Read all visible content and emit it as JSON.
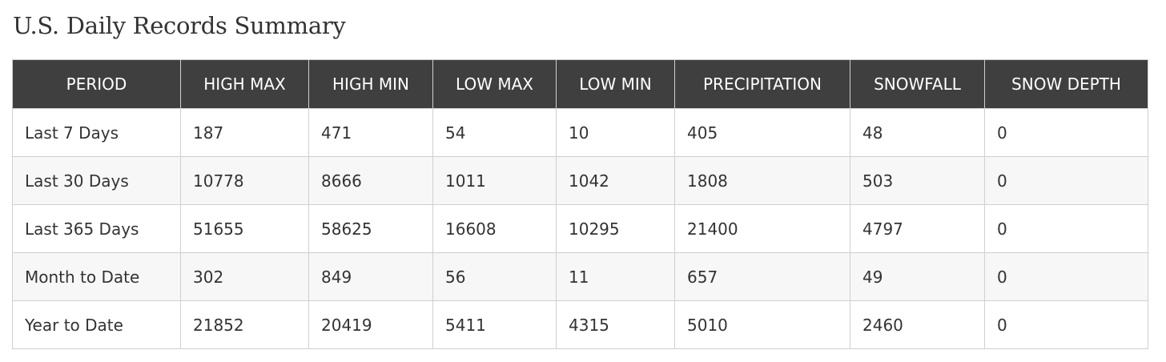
{
  "title": "U.S. Daily Records Summary",
  "table": {
    "headers": [
      "PERIOD",
      "HIGH MAX",
      "HIGH MIN",
      "LOW MAX",
      "LOW MIN",
      "PRECIPITATION",
      "SNOWFALL",
      "SNOW DEPTH"
    ],
    "rows": [
      [
        "Last 7 Days",
        "187",
        "471",
        "54",
        "10",
        "405",
        "48",
        "0"
      ],
      [
        "Last 30 Days",
        "10778",
        "8666",
        "1011",
        "1042",
        "1808",
        "503",
        "0"
      ],
      [
        "Last 365 Days",
        "51655",
        "58625",
        "16608",
        "10295",
        "21400",
        "4797",
        "0"
      ],
      [
        "Month to Date",
        "302",
        "849",
        "56",
        "11",
        "657",
        "49",
        "0"
      ],
      [
        "Year to Date",
        "21852",
        "20419",
        "5411",
        "4315",
        "5010",
        "2460",
        "0"
      ]
    ]
  },
  "colors": {
    "header_background": "#3f3f3f",
    "header_text": "#ffffff",
    "body_text": "#333333",
    "stripe": "#f7f7f7",
    "border": "#d0d0d0"
  }
}
